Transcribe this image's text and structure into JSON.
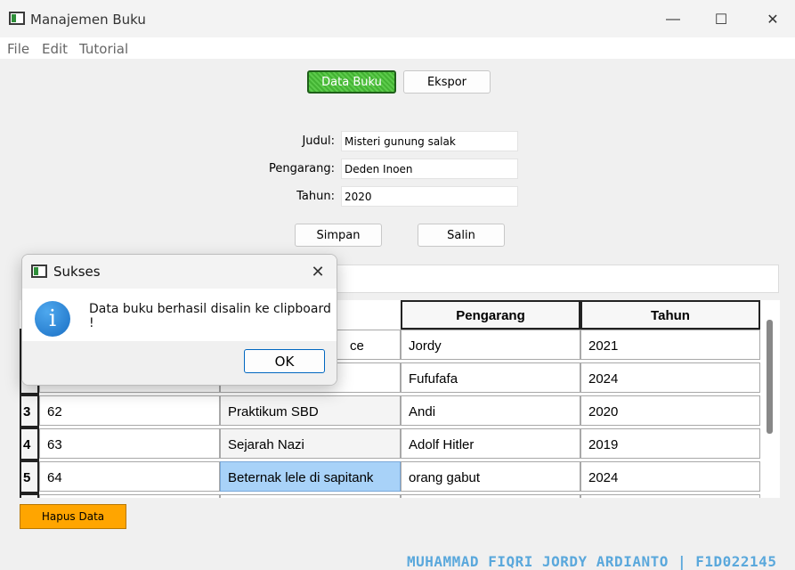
{
  "window": {
    "title": "Manajemen Buku",
    "minimize": "—",
    "maximize": "☐",
    "close": "✕"
  },
  "menu": [
    "File",
    "Edit",
    "Tutorial"
  ],
  "toolbar": {
    "data_buku": "Data Buku",
    "ekspor": "Ekspor"
  },
  "form": {
    "judul_label": "Judul:",
    "judul_value": "Misteri gunung salak",
    "pengarang_label": "Pengarang:",
    "pengarang_value": "Deden Inoen",
    "tahun_label": "Tahun:",
    "tahun_value": "2020"
  },
  "actions": {
    "simpan": "Simpan",
    "salin": "Salin"
  },
  "table": {
    "headers": [
      "Pengarang",
      "Tahun"
    ],
    "rows": [
      {
        "num": "",
        "id": "",
        "judul": "ce",
        "pengarang": "Jordy",
        "tahun": "2021"
      },
      {
        "num": "",
        "id": "",
        "judul": "",
        "pengarang": "Fufufafa",
        "tahun": "2024"
      },
      {
        "num": "3",
        "id": "62",
        "judul": "Praktikum SBD",
        "pengarang": "Andi",
        "tahun": "2020"
      },
      {
        "num": "4",
        "id": "63",
        "judul": "Sejarah Nazi",
        "pengarang": "Adolf Hitler",
        "tahun": "2019"
      },
      {
        "num": "5",
        "id": "64",
        "judul": "Beternak lele di sapitank",
        "pengarang": "orang gabut",
        "tahun": "2024"
      }
    ]
  },
  "hapus_button": "Hapus Data",
  "footer": "MUHAMMAD FIQRI JORDY ARDIANTO | F1D022145",
  "dialog": {
    "title": "Sukses",
    "close": "✕",
    "icon": "info-icon",
    "icon_glyph": "i",
    "message": "Data buku berhasil disalin ke clipboard !",
    "ok": "OK"
  },
  "colors": {
    "active_button": "#43b233",
    "hapus_button": "#ffa500",
    "selected_cell": "#a8d2f8",
    "footer_text": "#5aa8dc"
  }
}
